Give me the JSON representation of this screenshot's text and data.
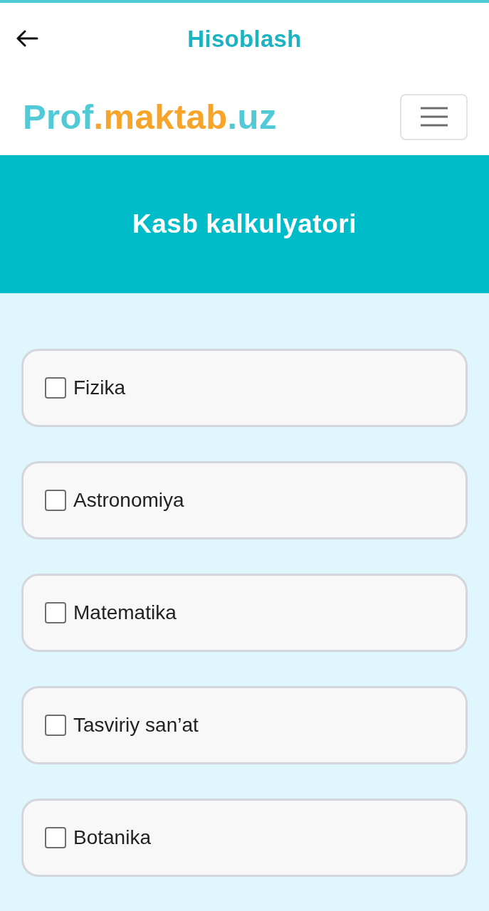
{
  "app_bar": {
    "title": "Hisoblash"
  },
  "navbar": {
    "logo": [
      {
        "text": "Prof",
        "color": "#4fcad6"
      },
      {
        "text": ".maktab",
        "color": "#f7a42a"
      },
      {
        "text": ".uz",
        "color": "#4fcad6"
      }
    ]
  },
  "hero": {
    "title": "Kasb kalkulyatori"
  },
  "subjects": [
    {
      "label": "Fizika",
      "checked": false
    },
    {
      "label": "Astronomiya",
      "checked": false
    },
    {
      "label": "Matematika",
      "checked": false
    },
    {
      "label": "Tasviriy san’at",
      "checked": false
    },
    {
      "label": "Botanika",
      "checked": false
    }
  ]
}
